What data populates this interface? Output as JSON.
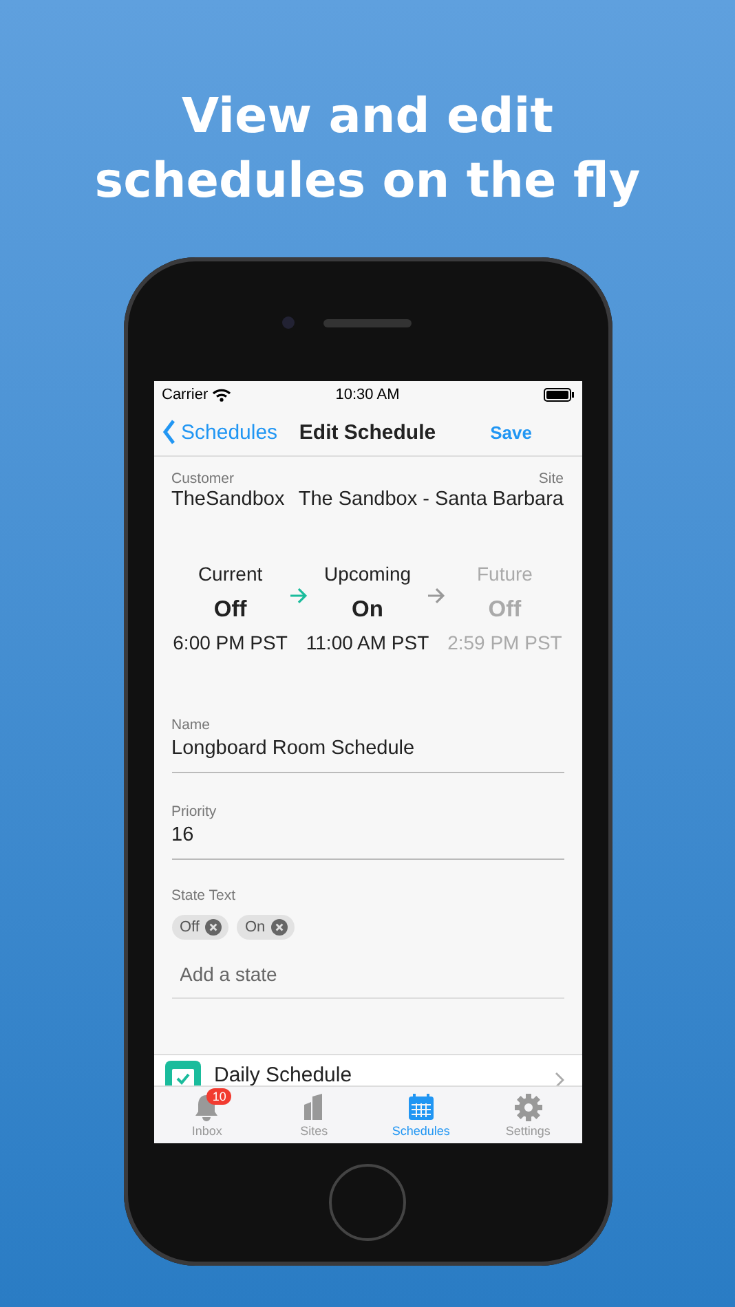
{
  "headline": [
    "View and edit",
    "schedules on the fly"
  ],
  "status_bar": {
    "carrier": "Carrier",
    "time": "10:30 AM"
  },
  "nav": {
    "back": "Schedules",
    "title": "Edit Schedule",
    "action": "Save"
  },
  "customer": {
    "label": "Customer",
    "value": "TheSandbox"
  },
  "site": {
    "label": "Site",
    "value": "The Sandbox - Santa Barbara"
  },
  "timeline": [
    {
      "label": "Current",
      "state": "Off",
      "time": "6:00 PM PST",
      "dimmed": false
    },
    {
      "label": "Upcoming",
      "state": "On",
      "time": "11:00 AM PST",
      "dimmed": false
    },
    {
      "label": "Future",
      "state": "Off",
      "time": "2:59 PM PST",
      "dimmed": true
    }
  ],
  "fields": [
    {
      "label": "Name",
      "value": "Longboard Room Schedule"
    },
    {
      "label": "Priority",
      "value": "16"
    }
  ],
  "state_text": {
    "label": "State Text",
    "chips": [
      {
        "label": "Off"
      },
      {
        "label": "On"
      }
    ],
    "placeholder": "Add a state"
  },
  "list_item": {
    "label": "Daily Schedule"
  },
  "tab_bar": [
    {
      "label": "Inbox",
      "selected": false,
      "badge": "10",
      "kind": "bell"
    },
    {
      "label": "Sites",
      "selected": false,
      "kind": "building"
    },
    {
      "label": "Schedules",
      "selected": true,
      "kind": "calendar"
    },
    {
      "label": "Settings",
      "selected": false,
      "kind": "gear"
    }
  ]
}
